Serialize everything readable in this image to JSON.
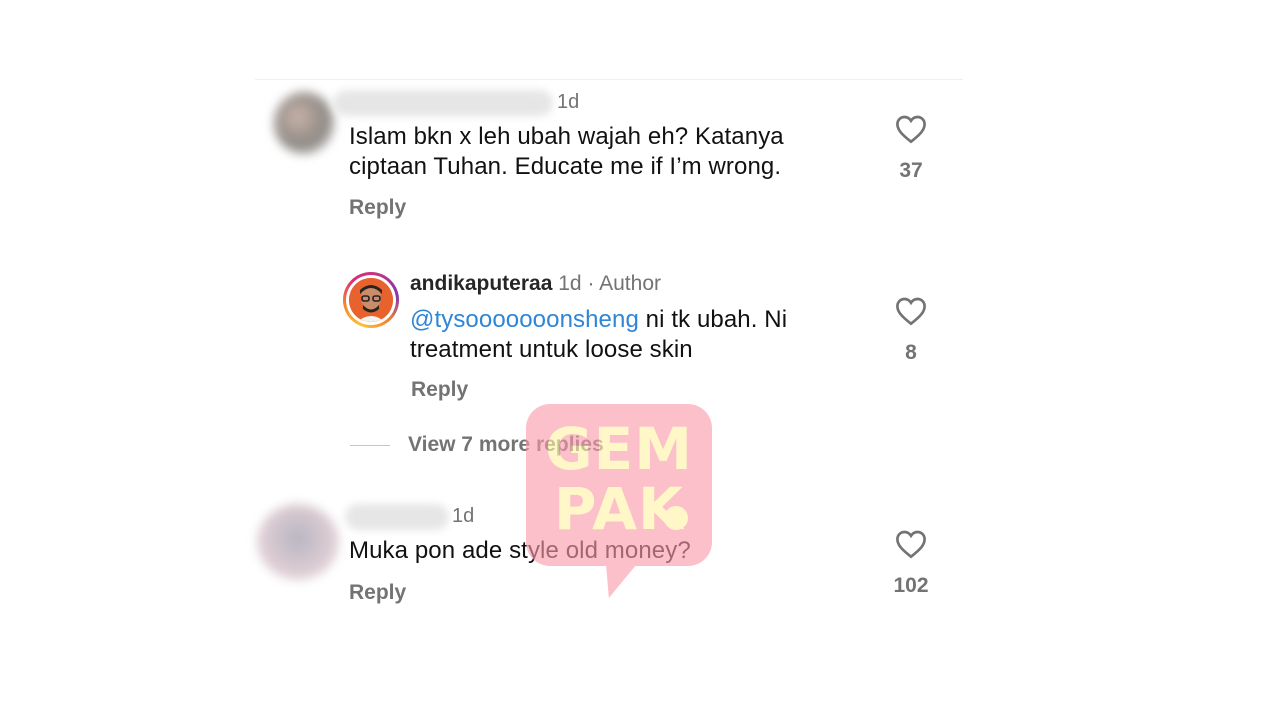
{
  "comments": [
    {
      "time": "1d",
      "text_line1": "Islam bkn x leh ubah wajah eh? Katanya",
      "text_line2": "ciptaan Tuhan. Educate me if I’m wrong.",
      "reply_label": "Reply",
      "likes": "37"
    },
    {
      "time": "1d",
      "text": "Muka pon ade style old money?",
      "reply_label": "Reply",
      "likes": "102"
    }
  ],
  "author_reply": {
    "username": "andikaputeraa",
    "time": "1d",
    "separator": "·",
    "badge": "Author",
    "mention": "@tysooooooonsheng",
    "text_line1_rest": " ni tk ubah. Ni",
    "text_line2": "treatment untuk loose skin",
    "reply_label": "Reply",
    "likes": "8"
  },
  "view_more_replies": "View 7 more replies",
  "watermark": {
    "line1": "GEM",
    "line2": "PAK"
  },
  "colors": {
    "mention": "#2e86d6",
    "muted": "#737373",
    "watermark_bg": "#fb9bab",
    "watermark_text": "#fff3a8"
  },
  "icons": {
    "like": "heart-outline-icon"
  }
}
